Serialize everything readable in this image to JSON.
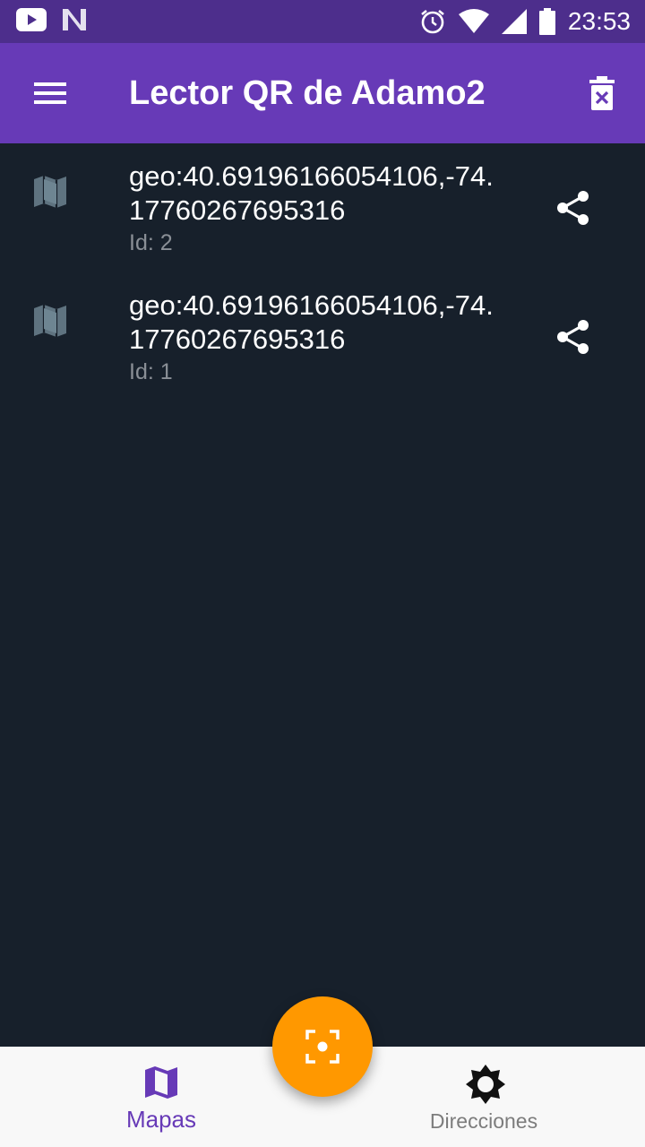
{
  "status_bar": {
    "time": "23:53",
    "icons": [
      "youtube-icon",
      "notification-n-icon",
      "alarm-icon",
      "wifi-icon",
      "signal-icon",
      "battery-icon"
    ]
  },
  "app_bar": {
    "title": "Lector QR de Adamo2",
    "menu_icon": "menu-icon",
    "delete_icon": "delete-icon",
    "background": "#673ab7"
  },
  "list": {
    "items": [
      {
        "value": "geo:40.69196166054106,-74.17760267695316",
        "id_label": "Id: 2",
        "icon": "map-icon",
        "action_icon": "share-icon"
      },
      {
        "value": "geo:40.69196166054106,-74.17760267695316",
        "id_label": "Id: 1",
        "icon": "map-icon",
        "action_icon": "share-icon"
      }
    ]
  },
  "fab": {
    "icon": "qr-scan-icon",
    "color": "#ff9800"
  },
  "bottom_nav": {
    "items": [
      {
        "label": "Mapas",
        "icon": "map-icon",
        "active": true
      },
      {
        "label": "Direcciones",
        "icon": "brightness-icon",
        "active": false
      }
    ],
    "active_color": "#673ab7"
  }
}
